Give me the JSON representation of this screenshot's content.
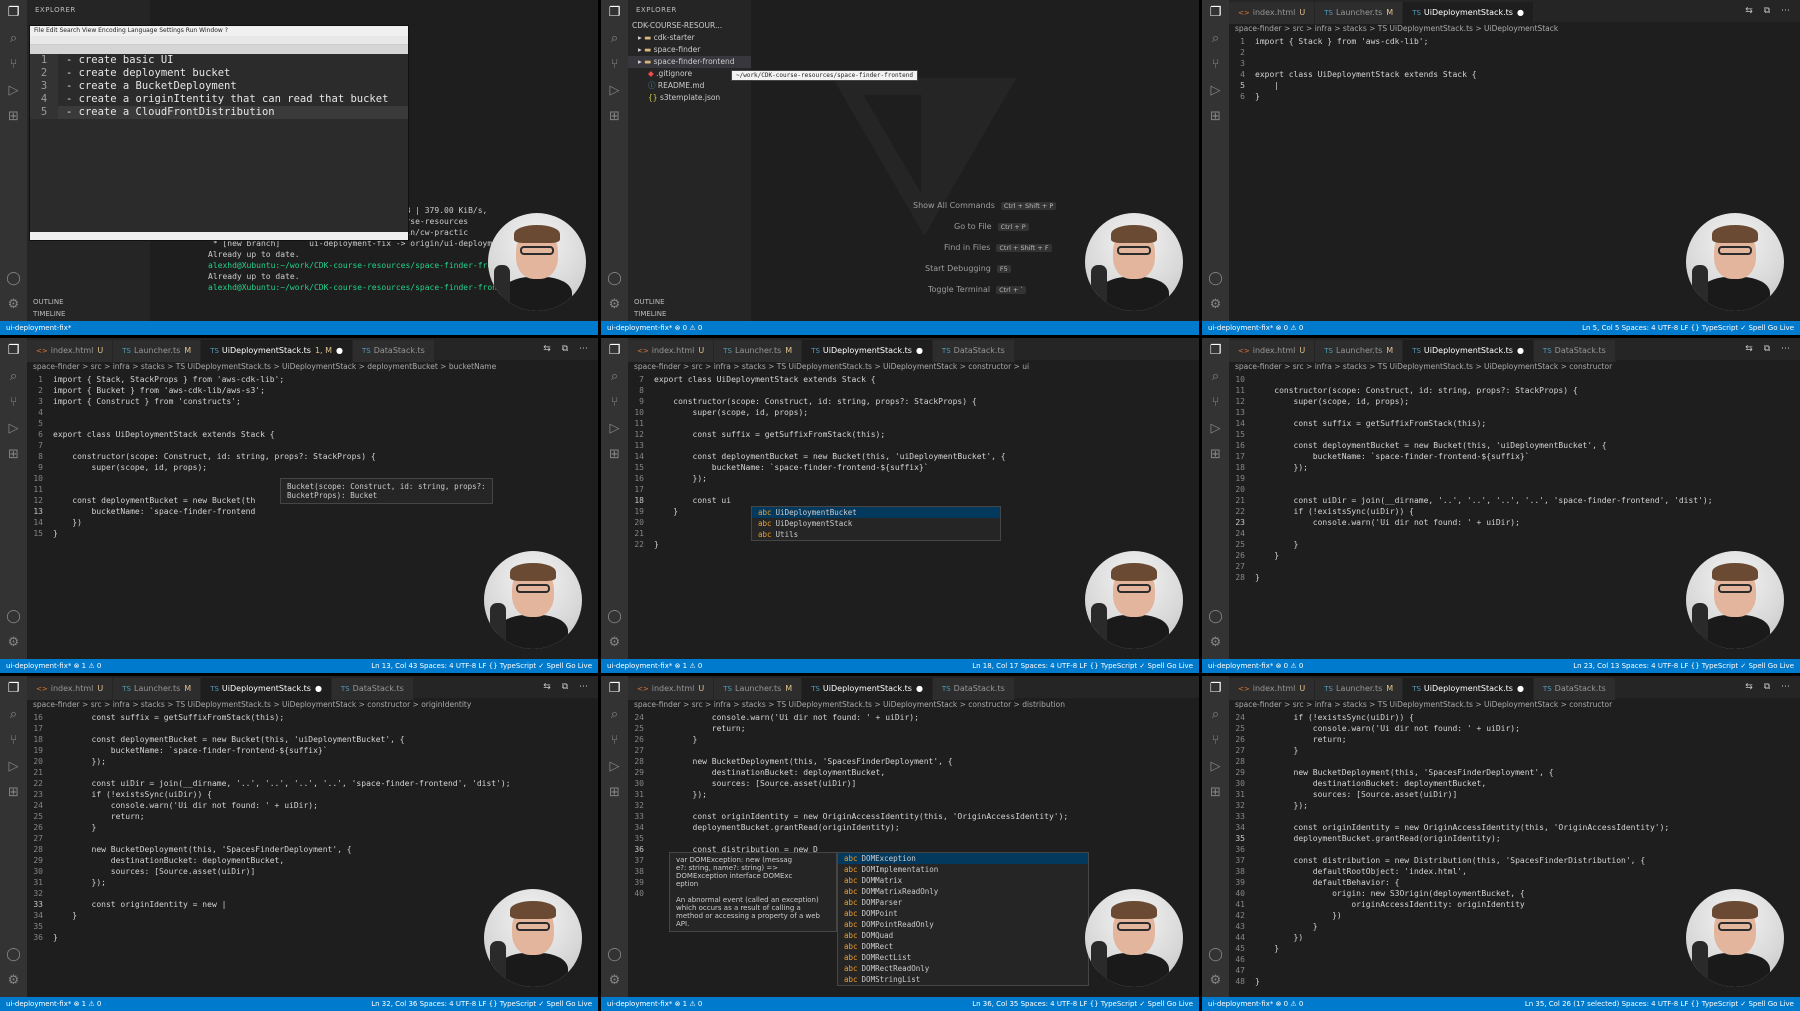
{
  "tabs": {
    "index": "index.html",
    "launcher": "Launcher.ts",
    "ui_stack": "UiDeploymentStack.ts",
    "data_stack": "DataStack.ts",
    "mod_u": "U",
    "mod_m": "M",
    "mod_1m": "1, M"
  },
  "breadcrumbs": {
    "p3": "space-finder > src > infra > stacks > TS UiDeploymentStack.ts > UiDeploymentStack",
    "p4": "space-finder > src > infra > stacks > TS UiDeploymentStack.ts > UiDeploymentStack > deploymentBucket > bucketName",
    "p5": "space-finder > src > infra > stacks > TS UiDeploymentStack.ts > UiDeploymentStack > constructor > ui",
    "p6": "space-finder > src > infra > stacks > TS UiDeploymentStack.ts > UiDeploymentStack > constructor",
    "p7": "space-finder > src > infra > stacks > TS UiDeploymentStack.ts > UiDeploymentStack > constructor > originIdentity",
    "p8": "space-finder > src > infra > stacks > TS UiDeploymentStack.ts > UiDeploymentStack > constructor > distribution",
    "p9": "space-finder > src > infra > stacks > TS UiDeploymentStack.ts > UiDeploymentStack > constructor"
  },
  "status": {
    "branch": "ui-deployment-fix*",
    "problems": "⊗ 1 ⚠ 0",
    "problems0": "⊗ 0 ⚠ 0",
    "p4_pos": "Ln 13, Col 43   Spaces: 4   UTF-8   LF   {} TypeScript   ✓ Spell   Go Live",
    "p5_pos": "Ln 18, Col 17   Spaces: 4   UTF-8   LF   {} TypeScript   ✓ Spell   Go Live",
    "p6_pos": "Ln 23, Col 13   Spaces: 4   UTF-8   LF   {} TypeScript   ✓ Spell   Go Live",
    "p7_pos": "Ln 32, Col 36   Spaces: 4   UTF-8   LF   {} TypeScript   ✓ Spell   Go Live",
    "p8_pos": "Ln 36, Col 35   Spaces: 4   UTF-8   LF   {} TypeScript   ✓ Spell   Go Live",
    "p9_pos": "Ln 35, Col 26 (17 selected)   Spaces: 4   UTF-8   LF   {} TypeScript   ✓ Spell   Go Live",
    "p3_pos": "Ln 5, Col 5   Spaces: 4   UTF-8   LF   {} TypeScript   ✓ Spell   Go Live"
  },
  "panel1": {
    "explorer": "EXPLORER",
    "notes": [
      "- create basic UI",
      "- create deployment bucket",
      "- create a BucketDeployment",
      "- create a originItentity that can read that bucket",
      "- create a CloudFrontDistribution"
    ],
    "note_menu": "File  Edit  Search  View  Encoding  Language  Settings  Run  Window  ?",
    "terminal": [
      "Unpacking objects: 100% (47/47), 25.17 KiB | 379.00 KiB/s,",
      "From https://github.com/alexhddev/CDK-course-resources",
      " * [new branch]      cw-practice  -> origin/cw-practic",
      " * [new branch]      ui-deployment-fix -> origin/ui-deploym",
      "Already up to date.",
      "alexhd@Xubuntu:~/work/CDK-course-resources/space-finder-fron",
      "Already up to date.",
      "alexhd@Xubuntu:~/work/CDK-course-resources/space-finder-frontend$"
    ],
    "outline": "OUTLINE",
    "timeline": "TIMELINE"
  },
  "panel2": {
    "explorer": "EXPLORER",
    "root": "CDK-COURSE-RESOUR...",
    "items": [
      "cdk-starter",
      "space-finder",
      "space-finder-frontend",
      ".gitignore",
      "README.md",
      "s3template.json"
    ],
    "tooltip": "~/work/CDK-course-resources/space-finder-frontend",
    "shortcuts": [
      {
        "label": "Show All Commands",
        "keys": "Ctrl + Shift + P"
      },
      {
        "label": "Go to File",
        "keys": "Ctrl + P"
      },
      {
        "label": "Find in Files",
        "keys": "Ctrl + Shift + F"
      },
      {
        "label": "Start Debugging",
        "keys": "F5"
      },
      {
        "label": "Toggle Terminal",
        "keys": "Ctrl + `"
      }
    ],
    "outline": "OUTLINE",
    "timeline": "TIMELINE"
  },
  "panel3": {
    "lines": [
      {
        "n": "1",
        "t": "import { Stack } from 'aws-cdk-lib';"
      },
      {
        "n": "2",
        "t": ""
      },
      {
        "n": "3",
        "t": ""
      },
      {
        "n": "4",
        "t": "export class UiDeploymentStack extends Stack {"
      },
      {
        "n": "5",
        "t": "    |"
      },
      {
        "n": "6",
        "t": "}"
      }
    ]
  },
  "panel4": {
    "lines": [
      {
        "n": "1",
        "t": "import { Stack, StackProps } from 'aws-cdk-lib';"
      },
      {
        "n": "2",
        "t": "import { Bucket } from 'aws-cdk-lib/aws-s3';"
      },
      {
        "n": "3",
        "t": "import { Construct } from 'constructs';"
      },
      {
        "n": "4",
        "t": ""
      },
      {
        "n": "5",
        "t": ""
      },
      {
        "n": "6",
        "t": "export class UiDeploymentStack extends Stack {"
      },
      {
        "n": "7",
        "t": ""
      },
      {
        "n": "8",
        "t": "    constructor(scope: Construct, id: string, props?: StackProps) {"
      },
      {
        "n": "9",
        "t": "        super(scope, id, props);"
      },
      {
        "n": "10",
        "t": ""
      },
      {
        "n": "11",
        "t": ""
      },
      {
        "n": "12",
        "t": "    const deploymentBucket = new Bucket(th"
      },
      {
        "n": "13",
        "t": "        bucketName: `space-finder-frontend"
      },
      {
        "n": "14",
        "t": "    })"
      },
      {
        "n": "15",
        "t": "}"
      }
    ],
    "tooltip": "Bucket(scope: Construct, id: string, props?:\nBucketProps): Bucket"
  },
  "panel5": {
    "lines": [
      {
        "n": "7",
        "t": "export class UiDeploymentStack extends Stack {"
      },
      {
        "n": "8",
        "t": ""
      },
      {
        "n": "9",
        "t": "    constructor(scope: Construct, id: string, props?: StackProps) {"
      },
      {
        "n": "10",
        "t": "        super(scope, id, props);"
      },
      {
        "n": "11",
        "t": ""
      },
      {
        "n": "12",
        "t": "        const suffix = getSuffixFromStack(this);"
      },
      {
        "n": "13",
        "t": ""
      },
      {
        "n": "14",
        "t": "        const deploymentBucket = new Bucket(this, 'uiDeploymentBucket', {"
      },
      {
        "n": "15",
        "t": "            bucketName: `space-finder-frontend-${suffix}`"
      },
      {
        "n": "16",
        "t": "        });"
      },
      {
        "n": "17",
        "t": ""
      },
      {
        "n": "18",
        "t": "        const ui"
      },
      {
        "n": "19",
        "t": "    }"
      },
      {
        "n": "20",
        "t": ""
      },
      {
        "n": "21",
        "t": ""
      },
      {
        "n": "22",
        "t": "}"
      }
    ],
    "suggest": [
      "UiDeploymentBucket",
      "UiDeploymentStack",
      "Utils"
    ]
  },
  "panel6": {
    "lines": [
      {
        "n": "10",
        "t": ""
      },
      {
        "n": "11",
        "t": "    constructor(scope: Construct, id: string, props?: StackProps) {"
      },
      {
        "n": "12",
        "t": "        super(scope, id, props);"
      },
      {
        "n": "13",
        "t": ""
      },
      {
        "n": "14",
        "t": "        const suffix = getSuffixFromStack(this);"
      },
      {
        "n": "15",
        "t": ""
      },
      {
        "n": "16",
        "t": "        const deploymentBucket = new Bucket(this, 'uiDeploymentBucket', {"
      },
      {
        "n": "17",
        "t": "            bucketName: `space-finder-frontend-${suffix}`"
      },
      {
        "n": "18",
        "t": "        });"
      },
      {
        "n": "19",
        "t": ""
      },
      {
        "n": "20",
        "t": ""
      },
      {
        "n": "21",
        "t": "        const uiDir = join(__dirname, '..', '..', '..', '..', 'space-finder-frontend', 'dist');"
      },
      {
        "n": "22",
        "t": "        if (!existsSync(uiDir)) {"
      },
      {
        "n": "23",
        "t": "            console.warn('Ui dir not found: ' + uiDir);"
      },
      {
        "n": "24",
        "t": ""
      },
      {
        "n": "25",
        "t": "        }"
      },
      {
        "n": "26",
        "t": "    }"
      },
      {
        "n": "27",
        "t": ""
      },
      {
        "n": "28",
        "t": "}"
      }
    ]
  },
  "panel7": {
    "lines": [
      {
        "n": "16",
        "t": "        const suffix = getSuffixFromStack(this);"
      },
      {
        "n": "17",
        "t": ""
      },
      {
        "n": "18",
        "t": "        const deploymentBucket = new Bucket(this, 'uiDeploymentBucket', {"
      },
      {
        "n": "19",
        "t": "            bucketName: `space-finder-frontend-${suffix}`"
      },
      {
        "n": "20",
        "t": "        });"
      },
      {
        "n": "21",
        "t": ""
      },
      {
        "n": "22",
        "t": "        const uiDir = join(__dirname, '..', '..', '..', '..', 'space-finder-frontend', 'dist');"
      },
      {
        "n": "23",
        "t": "        if (!existsSync(uiDir)) {"
      },
      {
        "n": "24",
        "t": "            console.warn('Ui dir not found: ' + uiDir);"
      },
      {
        "n": "25",
        "t": "            return;"
      },
      {
        "n": "26",
        "t": "        }"
      },
      {
        "n": "27",
        "t": ""
      },
      {
        "n": "28",
        "t": "        new BucketDeployment(this, 'SpacesFinderDeployment', {"
      },
      {
        "n": "29",
        "t": "            destinationBucket: deploymentBucket,"
      },
      {
        "n": "30",
        "t": "            sources: [Source.asset(uiDir)]"
      },
      {
        "n": "31",
        "t": "        });"
      },
      {
        "n": "32",
        "t": ""
      },
      {
        "n": "33",
        "t": "        const originIdentity = new |"
      },
      {
        "n": "34",
        "t": "    }"
      },
      {
        "n": "35",
        "t": ""
      },
      {
        "n": "36",
        "t": "}"
      }
    ]
  },
  "panel8": {
    "lines": [
      {
        "n": "24",
        "t": "            console.warn('Ui dir not found: ' + uiDir);"
      },
      {
        "n": "25",
        "t": "            return;"
      },
      {
        "n": "26",
        "t": "        }"
      },
      {
        "n": "27",
        "t": ""
      },
      {
        "n": "28",
        "t": "        new BucketDeployment(this, 'SpacesFinderDeployment', {"
      },
      {
        "n": "29",
        "t": "            destinationBucket: deploymentBucket,"
      },
      {
        "n": "30",
        "t": "            sources: [Source.asset(uiDir)]"
      },
      {
        "n": "31",
        "t": "        });"
      },
      {
        "n": "32",
        "t": ""
      },
      {
        "n": "33",
        "t": "        const originIdentity = new OriginAccessIdentity(this, 'OriginAccessIdentity');"
      },
      {
        "n": "34",
        "t": "        deploymentBucket.grantRead(originIdentity);"
      },
      {
        "n": "35",
        "t": ""
      },
      {
        "n": "36",
        "t": "        const distribution = new D"
      },
      {
        "n": "37",
        "t": ""
      },
      {
        "n": "38",
        "t": ""
      },
      {
        "n": "39",
        "t": ""
      },
      {
        "n": "40",
        "t": ""
      }
    ],
    "doc": "var DOMException: new (messag\ne?: string, name?: string) =>\nDOMException interface DOMExc\neption\n\nAn abnormal event (called an exception)\nwhich occurs as a result of calling a\nmethod or accessing a property of a web\nAPI.",
    "suggest": [
      "DOMException",
      "DOMImplementation",
      "DOMMatrix",
      "DOMMatrixReadOnly",
      "DOMParser",
      "DOMPoint",
      "DOMPointReadOnly",
      "DOMQuad",
      "DOMRect",
      "DOMRectList",
      "DOMRectReadOnly",
      "DOMStringList"
    ]
  },
  "panel9": {
    "lines": [
      {
        "n": "24",
        "t": "        if (!existsSync(uiDir)) {"
      },
      {
        "n": "25",
        "t": "            console.warn('Ui dir not found: ' + uiDir);"
      },
      {
        "n": "26",
        "t": "            return;"
      },
      {
        "n": "27",
        "t": "        }"
      },
      {
        "n": "28",
        "t": ""
      },
      {
        "n": "29",
        "t": "        new BucketDeployment(this, 'SpacesFinderDeployment', {"
      },
      {
        "n": "30",
        "t": "            destinationBucket: deploymentBucket,"
      },
      {
        "n": "31",
        "t": "            sources: [Source.asset(uiDir)]"
      },
      {
        "n": "32",
        "t": "        });"
      },
      {
        "n": "33",
        "t": ""
      },
      {
        "n": "34",
        "t": "        const originIdentity = new OriginAccessIdentity(this, 'OriginAccessIdentity');"
      },
      {
        "n": "35",
        "t": "        deploymentBucket.grantRead(originIdentity);"
      },
      {
        "n": "36",
        "t": ""
      },
      {
        "n": "37",
        "t": "        const distribution = new Distribution(this, 'SpacesFinderDistribution', {"
      },
      {
        "n": "38",
        "t": "            defaultRootObject: 'index.html',"
      },
      {
        "n": "39",
        "t": "            defaultBehavior: {"
      },
      {
        "n": "40",
        "t": "                origin: new S3Origin(deploymentBucket, {"
      },
      {
        "n": "41",
        "t": "                    originAccessIdentity: originIdentity"
      },
      {
        "n": "42",
        "t": "                })"
      },
      {
        "n": "43",
        "t": "            }"
      },
      {
        "n": "44",
        "t": "        })"
      },
      {
        "n": "45",
        "t": "    }"
      },
      {
        "n": "46",
        "t": ""
      },
      {
        "n": "47",
        "t": ""
      },
      {
        "n": "48",
        "t": "}"
      }
    ]
  },
  "colors": {
    "editor_bg": "#1e1e1e",
    "status_bg": "#007acc",
    "activity_bg": "#333333",
    "keyword": "#c586c0",
    "type": "#4ec9b0",
    "string": "#ce9178"
  }
}
